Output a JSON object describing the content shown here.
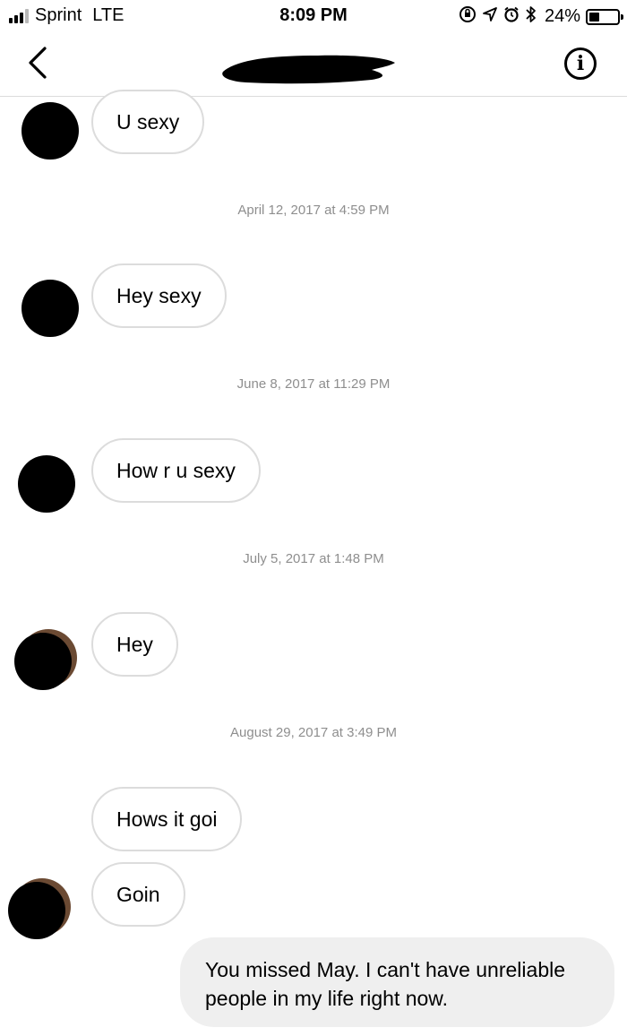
{
  "status_bar": {
    "carrier": "Sprint",
    "network": "LTE",
    "time": "8:09 PM",
    "battery": "24%",
    "battery_level": 0.24,
    "icons": [
      "signal-icon",
      "rotation-lock-icon",
      "location-icon",
      "alarm-icon",
      "bluetooth-icon",
      "battery-icon"
    ]
  },
  "header": {
    "back_icon": "chevron-left-icon",
    "contact_name_redacted": true,
    "info_icon": "info-icon",
    "info_glyph": "i"
  },
  "thread": {
    "messages": [
      {
        "direction": "incoming",
        "text": "U sexy"
      },
      {
        "type": "timestamp",
        "text": "April 12, 2017 at 4:59 PM"
      },
      {
        "direction": "incoming",
        "text": "Hey sexy"
      },
      {
        "type": "timestamp",
        "text": "June 8, 2017 at 11:29 PM"
      },
      {
        "direction": "incoming",
        "text": "How r u sexy"
      },
      {
        "type": "timestamp",
        "text": "July 5, 2017 at 1:48 PM"
      },
      {
        "direction": "incoming",
        "text": "Hey"
      },
      {
        "type": "timestamp",
        "text": "August 29, 2017 at 3:49 PM"
      },
      {
        "direction": "incoming",
        "text": "Hows it goi"
      },
      {
        "direction": "incoming",
        "text": "Goin"
      },
      {
        "direction": "outgoing",
        "text": "You missed May. I can't have unreliable people in my life right now."
      }
    ]
  },
  "colors": {
    "background": "#ffffff",
    "bubble_border": "#dcdcdc",
    "outgoing_bubble": "#efefef",
    "timestamp_text": "#8e8e8e"
  }
}
